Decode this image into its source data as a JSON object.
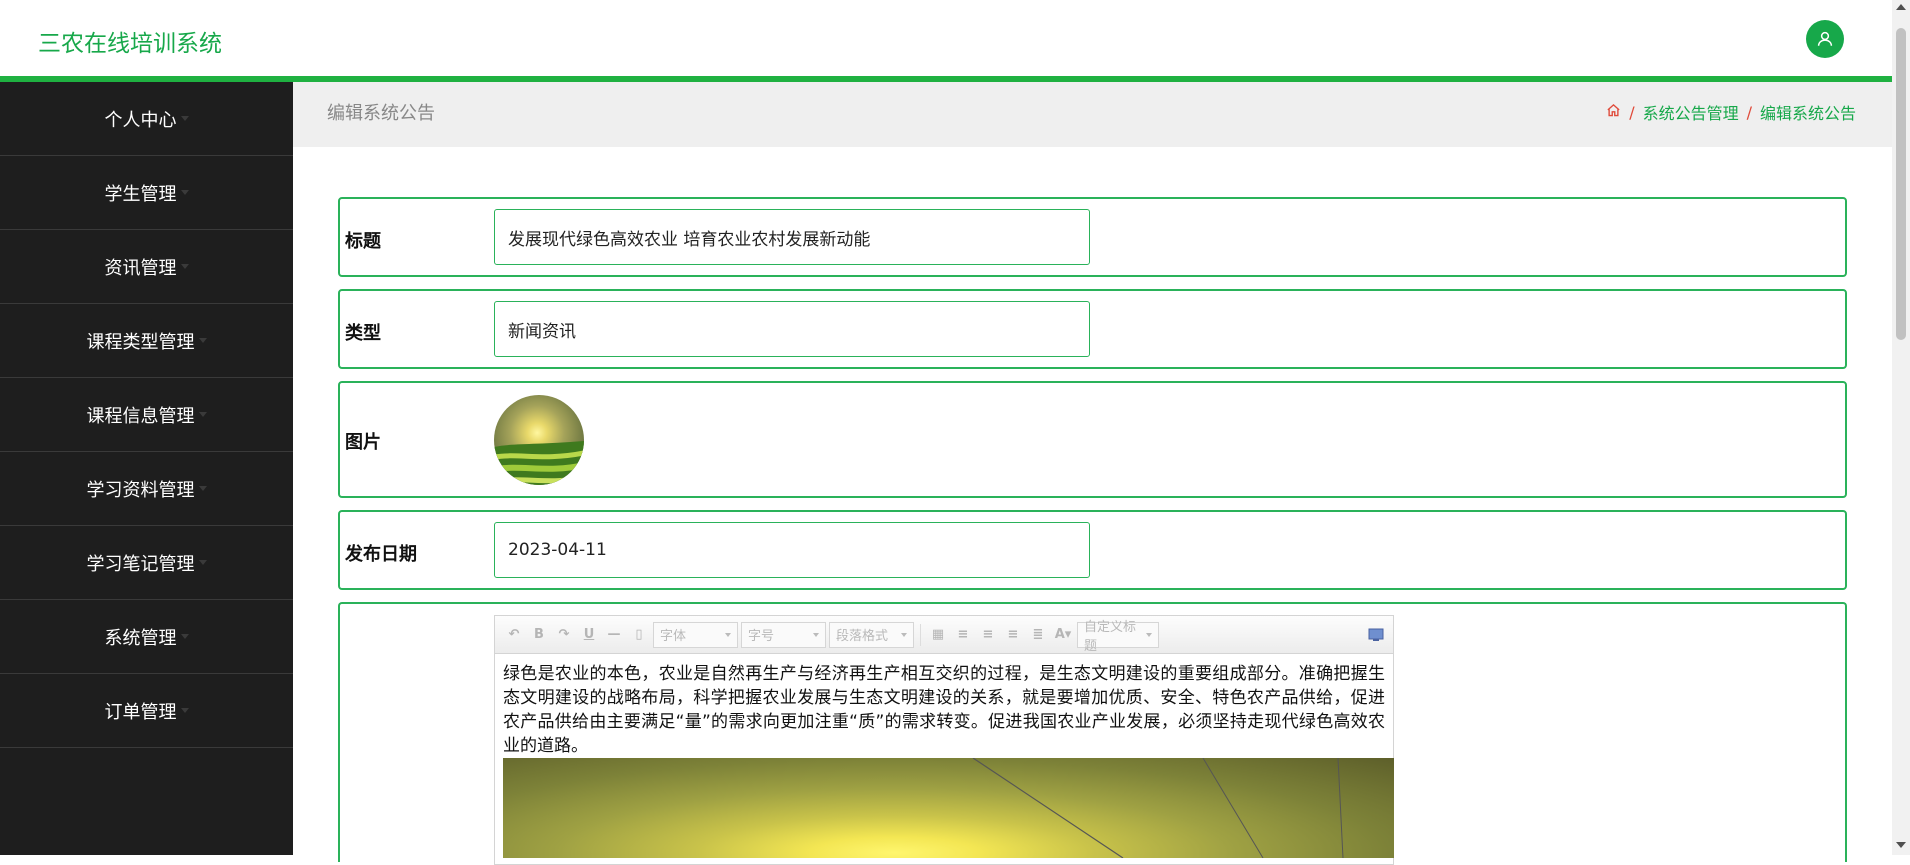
{
  "app": {
    "title": "三农在线培训系统"
  },
  "header": {
    "user_icon": "user-icon"
  },
  "sidebar": {
    "items": [
      {
        "label": "个人中心"
      },
      {
        "label": "学生管理"
      },
      {
        "label": "资讯管理"
      },
      {
        "label": "课程类型管理"
      },
      {
        "label": "课程信息管理"
      },
      {
        "label": "学习资料管理"
      },
      {
        "label": "学习笔记管理"
      },
      {
        "label": "系统管理"
      },
      {
        "label": "订单管理"
      }
    ]
  },
  "page": {
    "title": "编辑系统公告",
    "breadcrumb": {
      "home_icon": "home-icon",
      "sep": "/",
      "items": [
        "系统公告管理",
        "编辑系统公告"
      ]
    }
  },
  "form": {
    "title_label": "标题",
    "title_value": "发展现代绿色高效农业 培育农业农村发展新动能",
    "type_label": "类型",
    "type_value": "新闻资讯",
    "image_label": "图片",
    "date_label": "发布日期",
    "date_value": "2023-04-11"
  },
  "editor": {
    "toolbar": {
      "font_select": "字体",
      "size_select": "字号",
      "paragraph_select": "段落格式",
      "custom_title_select": "自定义标题"
    },
    "content": "绿色是农业的本色，农业是自然再生产与经济再生产相互交织的过程，是生态文明建设的重要组成部分。准确把握生态文明建设的战略布局，科学把握农业发展与生态文明建设的关系，就是要增加优质、安全、特色农产品供给，促进农产品供给由主要满足“量”的需求向更加注重“质”的需求转变。促进我国农业产业发展，必须坚持走现代绿色高效农业的道路。"
  },
  "colors": {
    "accent": "#17a84a",
    "sidebar_bg": "#1e1e1e",
    "breadcrumb_sep": "#e04a3a"
  }
}
